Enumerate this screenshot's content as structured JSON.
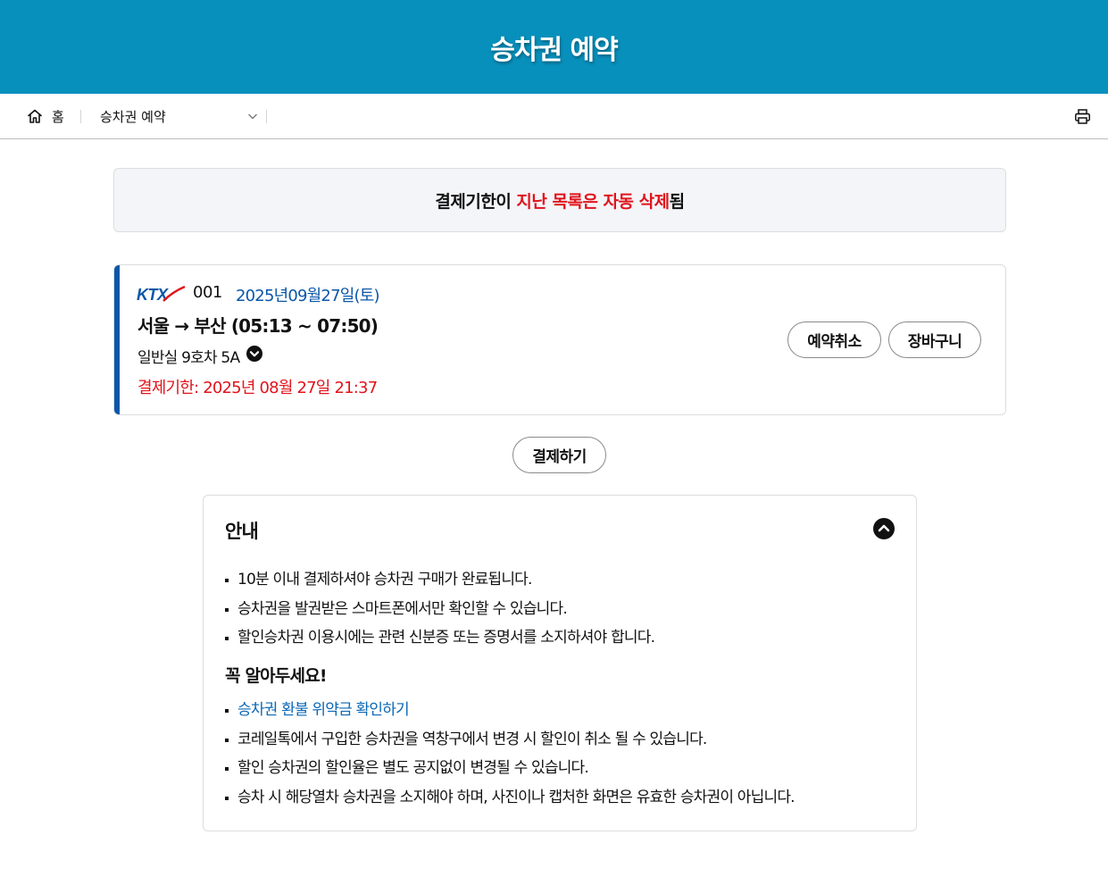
{
  "header": {
    "title": "승차권 예약"
  },
  "nav": {
    "home_label": "홈",
    "crumb_label": "승차권 예약"
  },
  "notice": {
    "text_normal_1": "결제기한이 ",
    "text_red": "지난 목록은 자동 삭제",
    "text_normal_2": "됨"
  },
  "ticket": {
    "brand": "KTX",
    "train_no": "001",
    "date": "2025년09월27일(토)",
    "route": "서울 → 부산 (05:13 ~ 07:50)",
    "seat": "일반실 9호차 5A",
    "deadline": "결제기한: 2025년 08월 27일 21:37",
    "cancel_label": "예약취소",
    "cart_label": "장바구니"
  },
  "pay_label": "결제하기",
  "guide": {
    "title": "안내",
    "items": [
      "10분 이내 결제하셔야 승차권 구매가 완료됩니다.",
      "승차권을 발권받은 스마트폰에서만 확인할 수 있습니다.",
      "할인승차권 이용시에는 관련 신분증 또는 증명서를 소지하셔야 합니다."
    ],
    "subhead": "꼭 알아두세요!",
    "link": "승차권 환불 위약금 확인하기",
    "notes": [
      "코레일톡에서 구입한 승차권을 역창구에서 변경 시 할인이 취소 될 수 있습니다.",
      "할인 승차권의 할인율은 별도 공지없이 변경될 수 있습니다.",
      "승차 시 해당열차 승차권을 소지해야 하며, 사진이나 캡처한 화면은 유효한 승차권이 아닙니다."
    ]
  },
  "colors": {
    "header_bg": "#0890bc",
    "accent_red": "#e1141c",
    "accent_blue": "#0b57a8",
    "link_blue": "#0b67b5"
  },
  "icons": {
    "home": "home-icon",
    "dropdown": "chevron-down-icon",
    "print": "printer-icon",
    "seat_toggle": "chevron-down-circle-icon",
    "collapse": "chevron-up-circle-icon"
  }
}
